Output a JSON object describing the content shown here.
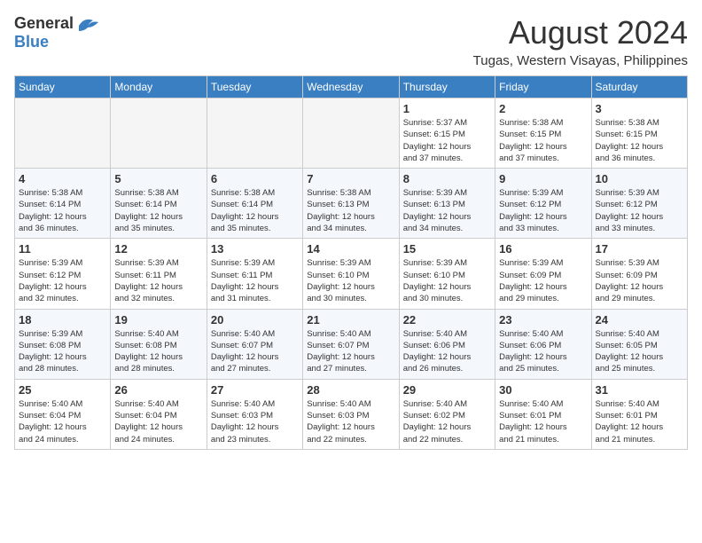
{
  "header": {
    "logo_general": "General",
    "logo_blue": "Blue",
    "month_year": "August 2024",
    "location": "Tugas, Western Visayas, Philippines"
  },
  "weekdays": [
    "Sunday",
    "Monday",
    "Tuesday",
    "Wednesday",
    "Thursday",
    "Friday",
    "Saturday"
  ],
  "weeks": [
    [
      {
        "day": "",
        "info": ""
      },
      {
        "day": "",
        "info": ""
      },
      {
        "day": "",
        "info": ""
      },
      {
        "day": "",
        "info": ""
      },
      {
        "day": "1",
        "info": "Sunrise: 5:37 AM\nSunset: 6:15 PM\nDaylight: 12 hours\nand 37 minutes."
      },
      {
        "day": "2",
        "info": "Sunrise: 5:38 AM\nSunset: 6:15 PM\nDaylight: 12 hours\nand 37 minutes."
      },
      {
        "day": "3",
        "info": "Sunrise: 5:38 AM\nSunset: 6:15 PM\nDaylight: 12 hours\nand 36 minutes."
      }
    ],
    [
      {
        "day": "4",
        "info": "Sunrise: 5:38 AM\nSunset: 6:14 PM\nDaylight: 12 hours\nand 36 minutes."
      },
      {
        "day": "5",
        "info": "Sunrise: 5:38 AM\nSunset: 6:14 PM\nDaylight: 12 hours\nand 35 minutes."
      },
      {
        "day": "6",
        "info": "Sunrise: 5:38 AM\nSunset: 6:14 PM\nDaylight: 12 hours\nand 35 minutes."
      },
      {
        "day": "7",
        "info": "Sunrise: 5:38 AM\nSunset: 6:13 PM\nDaylight: 12 hours\nand 34 minutes."
      },
      {
        "day": "8",
        "info": "Sunrise: 5:39 AM\nSunset: 6:13 PM\nDaylight: 12 hours\nand 34 minutes."
      },
      {
        "day": "9",
        "info": "Sunrise: 5:39 AM\nSunset: 6:12 PM\nDaylight: 12 hours\nand 33 minutes."
      },
      {
        "day": "10",
        "info": "Sunrise: 5:39 AM\nSunset: 6:12 PM\nDaylight: 12 hours\nand 33 minutes."
      }
    ],
    [
      {
        "day": "11",
        "info": "Sunrise: 5:39 AM\nSunset: 6:12 PM\nDaylight: 12 hours\nand 32 minutes."
      },
      {
        "day": "12",
        "info": "Sunrise: 5:39 AM\nSunset: 6:11 PM\nDaylight: 12 hours\nand 32 minutes."
      },
      {
        "day": "13",
        "info": "Sunrise: 5:39 AM\nSunset: 6:11 PM\nDaylight: 12 hours\nand 31 minutes."
      },
      {
        "day": "14",
        "info": "Sunrise: 5:39 AM\nSunset: 6:10 PM\nDaylight: 12 hours\nand 30 minutes."
      },
      {
        "day": "15",
        "info": "Sunrise: 5:39 AM\nSunset: 6:10 PM\nDaylight: 12 hours\nand 30 minutes."
      },
      {
        "day": "16",
        "info": "Sunrise: 5:39 AM\nSunset: 6:09 PM\nDaylight: 12 hours\nand 29 minutes."
      },
      {
        "day": "17",
        "info": "Sunrise: 5:39 AM\nSunset: 6:09 PM\nDaylight: 12 hours\nand 29 minutes."
      }
    ],
    [
      {
        "day": "18",
        "info": "Sunrise: 5:39 AM\nSunset: 6:08 PM\nDaylight: 12 hours\nand 28 minutes."
      },
      {
        "day": "19",
        "info": "Sunrise: 5:40 AM\nSunset: 6:08 PM\nDaylight: 12 hours\nand 28 minutes."
      },
      {
        "day": "20",
        "info": "Sunrise: 5:40 AM\nSunset: 6:07 PM\nDaylight: 12 hours\nand 27 minutes."
      },
      {
        "day": "21",
        "info": "Sunrise: 5:40 AM\nSunset: 6:07 PM\nDaylight: 12 hours\nand 27 minutes."
      },
      {
        "day": "22",
        "info": "Sunrise: 5:40 AM\nSunset: 6:06 PM\nDaylight: 12 hours\nand 26 minutes."
      },
      {
        "day": "23",
        "info": "Sunrise: 5:40 AM\nSunset: 6:06 PM\nDaylight: 12 hours\nand 25 minutes."
      },
      {
        "day": "24",
        "info": "Sunrise: 5:40 AM\nSunset: 6:05 PM\nDaylight: 12 hours\nand 25 minutes."
      }
    ],
    [
      {
        "day": "25",
        "info": "Sunrise: 5:40 AM\nSunset: 6:04 PM\nDaylight: 12 hours\nand 24 minutes."
      },
      {
        "day": "26",
        "info": "Sunrise: 5:40 AM\nSunset: 6:04 PM\nDaylight: 12 hours\nand 24 minutes."
      },
      {
        "day": "27",
        "info": "Sunrise: 5:40 AM\nSunset: 6:03 PM\nDaylight: 12 hours\nand 23 minutes."
      },
      {
        "day": "28",
        "info": "Sunrise: 5:40 AM\nSunset: 6:03 PM\nDaylight: 12 hours\nand 22 minutes."
      },
      {
        "day": "29",
        "info": "Sunrise: 5:40 AM\nSunset: 6:02 PM\nDaylight: 12 hours\nand 22 minutes."
      },
      {
        "day": "30",
        "info": "Sunrise: 5:40 AM\nSunset: 6:01 PM\nDaylight: 12 hours\nand 21 minutes."
      },
      {
        "day": "31",
        "info": "Sunrise: 5:40 AM\nSunset: 6:01 PM\nDaylight: 12 hours\nand 21 minutes."
      }
    ]
  ],
  "colors": {
    "header_bg": "#3a7fc1",
    "accent": "#3a7fc1"
  }
}
